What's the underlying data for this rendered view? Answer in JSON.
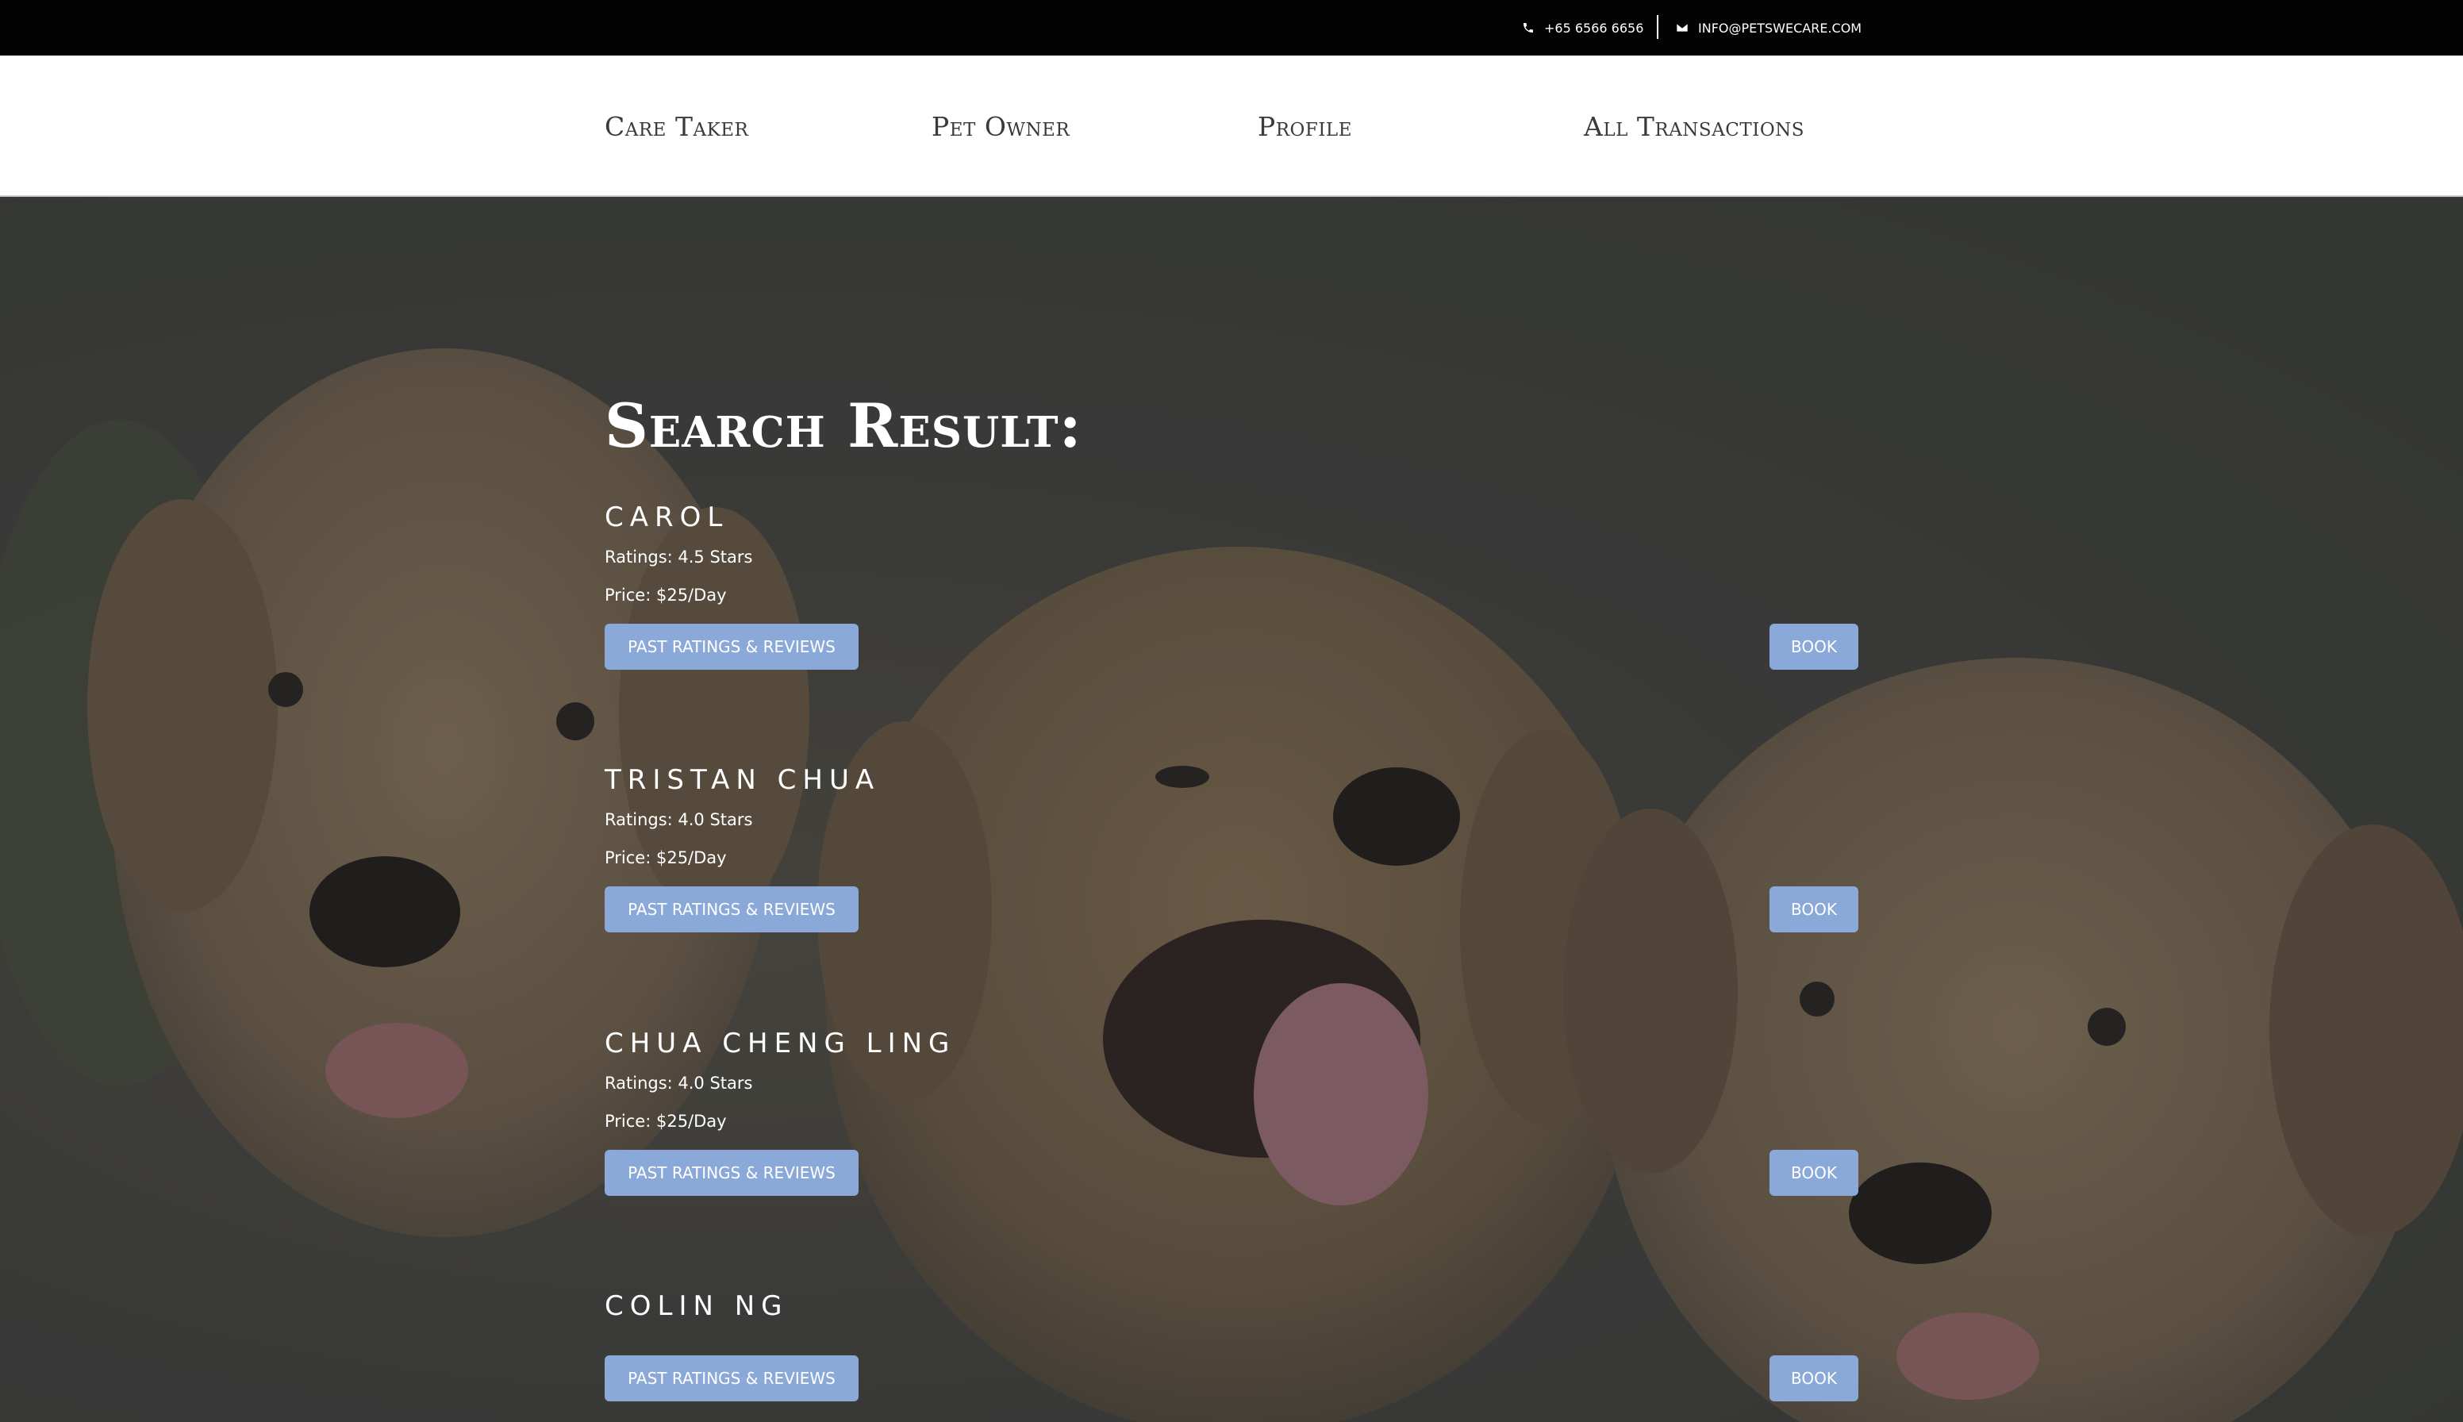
{
  "topbar": {
    "phone": "+65 6566 6656",
    "email": "INFO@PETSWECARE.COM",
    "phone_icon": "phone-icon",
    "email_icon": "envelope-icon"
  },
  "nav": {
    "items": [
      "Care Taker",
      "Pet Owner",
      "Profile",
      "All Transactions"
    ]
  },
  "main": {
    "title": "Search Result:",
    "caretakers": [
      {
        "name": "CAROL",
        "ratings": "Ratings: 4.5 Stars",
        "price": "Price: $25/Day",
        "reviews_label": "PAST RATINGS & REVIEWS",
        "book_label": "BOOK"
      },
      {
        "name": "TRISTAN CHUA",
        "ratings": "Ratings: 4.0 Stars",
        "price": "Price: $25/Day",
        "reviews_label": "PAST RATINGS & REVIEWS",
        "book_label": "BOOK"
      },
      {
        "name": "CHUA CHENG LING",
        "ratings": "Ratings: 4.0 Stars",
        "price": "Price: $25/Day",
        "reviews_label": "PAST RATINGS & REVIEWS",
        "book_label": "BOOK"
      },
      {
        "name": "COLIN NG",
        "reviews_label": "PAST RATINGS & REVIEWS",
        "book_label": "BOOK"
      }
    ]
  },
  "colors": {
    "topbar_bg": "#030303",
    "nav_bg": "#ffffff",
    "button_bg": "#8aa8d8",
    "text_light": "#ffffff"
  }
}
